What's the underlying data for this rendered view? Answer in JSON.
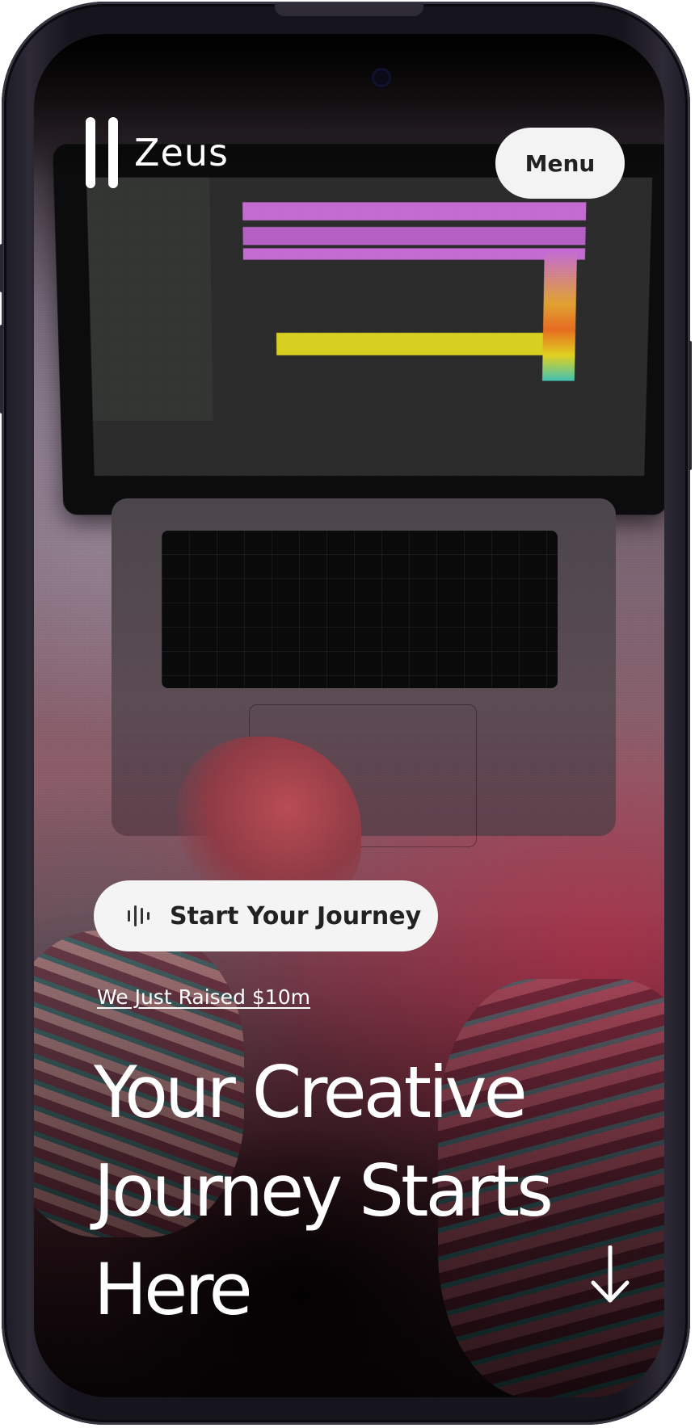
{
  "brand": {
    "name": "Zeus"
  },
  "nav": {
    "menu_label": "Menu"
  },
  "hero": {
    "cta_label": "Start Your Journey",
    "cta_icon": "sound-wave-icon",
    "announcement": "We Just Raised $10m",
    "headline": "Your Creative Journey Starts Here",
    "scroll_icon": "arrow-down-icon"
  },
  "colors": {
    "button_background": "#f4f4f4",
    "button_text": "#222222",
    "headline_text": "#ffffff"
  }
}
